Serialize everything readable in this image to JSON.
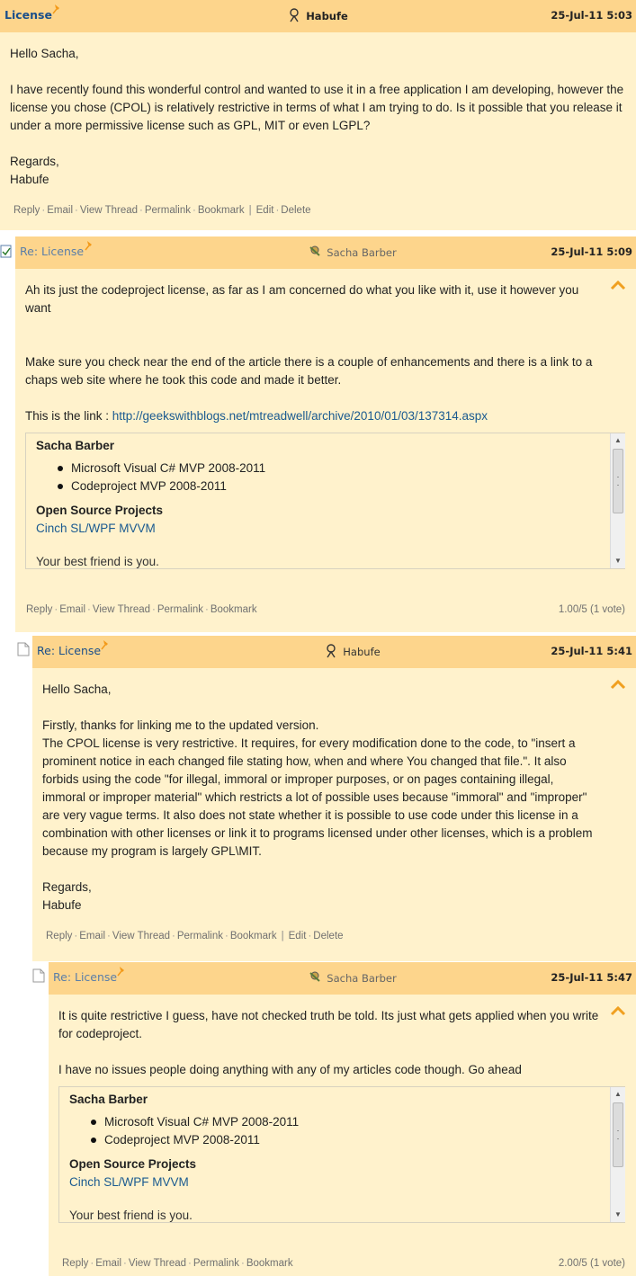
{
  "messages": [
    {
      "title": "License",
      "author": "Habufe",
      "date": "25-Jul-11 5:03",
      "paragraphs": [
        "Hello Sacha,",
        "",
        "I have recently found this wonderful control and wanted to use it in a free application I am developing, however the license you chose (CPOL) is relatively restrictive in terms of what I am trying to do. Is it possible that you release it under a more permissive license such as GPL, MIT or even LGPL?",
        "",
        "Regards,",
        "Habufe"
      ],
      "actions": [
        "Reply",
        "Email",
        "View Thread",
        "Permalink",
        "Bookmark"
      ],
      "owner_actions": [
        "Edit",
        "Delete"
      ]
    },
    {
      "title": "Re: License",
      "author": "Sacha Barber",
      "date": "25-Jul-11 5:09",
      "paragraphs": [
        "Ah its just the codeproject license, as far as I am concerned do what you like with it, use it however you want",
        "",
        "",
        "Make sure you check near the end of the article there is a couple of enhancements and there is a link to a chaps web site where he took this code and made it better.",
        ""
      ],
      "link_prefix": "This is the link : ",
      "link": "http://geekswithblogs.net/mtreadwell/archive/2010/01/03/137314.aspx",
      "signature": {
        "name": "Sacha Barber",
        "items": [
          "Microsoft Visual C# MVP 2008-2011",
          "Codeproject MVP 2008-2011"
        ],
        "heading": "Open Source Projects",
        "project": "Cinch SL/WPF MVVM",
        "more": "Your best friend is you."
      },
      "actions": [
        "Reply",
        "Email",
        "View Thread",
        "Permalink",
        "Bookmark"
      ],
      "rating": "1.00/5 (1 vote)"
    },
    {
      "title": "Re: License",
      "author": "Habufe",
      "date": "25-Jul-11 5:41",
      "paragraphs": [
        "Hello Sacha,",
        "",
        "Firstly, thanks for linking me to the updated version.",
        "The CPOL license is very restrictive. It requires, for every modification done to the code, to \"insert a prominent notice in each changed file stating how, when and where You changed that file.\". It also forbids using the code \"for illegal, immoral or improper purposes, or on pages containing illegal, immoral or improper material\" which restricts a lot of possible uses because \"immoral\" and \"improper\" are very vague terms. It also does not state whether it is possible to use code under this license in a combination with other licenses or link it to programs licensed under other licenses, which is a problem because my program is largely GPL\\MIT.",
        "",
        "Regards,",
        "Habufe"
      ],
      "actions": [
        "Reply",
        "Email",
        "View Thread",
        "Permalink",
        "Bookmark"
      ],
      "owner_actions": [
        "Edit",
        "Delete"
      ]
    },
    {
      "title": "Re: License",
      "author": "Sacha Barber",
      "date": "25-Jul-11 5:47",
      "paragraphs": [
        "It is quite restrictive I guess, have not checked truth be told. Its just what gets applied when you write for codeproject.",
        "",
        "I have no issues people doing anything with any of my articles code though. Go ahead"
      ],
      "signature": {
        "name": "Sacha Barber",
        "items": [
          "Microsoft Visual C# MVP 2008-2011",
          "Codeproject MVP 2008-2011"
        ],
        "heading": "Open Source Projects",
        "project": "Cinch SL/WPF MVVM",
        "more": "Your best friend is you."
      },
      "actions": [
        "Reply",
        "Email",
        "View Thread",
        "Permalink",
        "Bookmark"
      ],
      "rating": "2.00/5 (1 vote)"
    }
  ],
  "colors": {
    "header": "#fdd58c",
    "body": "#fff2cc",
    "title_link": "#1a4f8a",
    "accent_arrow": "#f0a020"
  }
}
